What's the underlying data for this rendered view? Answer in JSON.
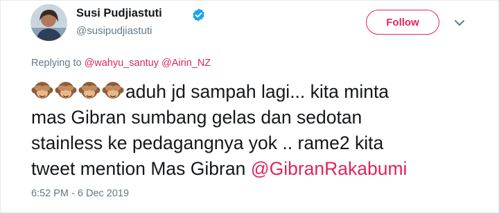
{
  "user": {
    "display_name": "Susi Pudjiastuti",
    "handle": "@susipudjiastuti",
    "verified": true
  },
  "follow_button": {
    "label": "Follow",
    "color": "#e0245e"
  },
  "more_menu": {
    "icon": "chevron-down-icon"
  },
  "reply": {
    "prefix": "Replying to",
    "mentions": [
      "@wahyu_santuy",
      "@Airin_NZ"
    ]
  },
  "tweet": {
    "emoji": [
      "see-no-evil-monkey",
      "see-no-evil-monkey",
      "see-no-evil-monkey",
      "see-no-evil-monkey"
    ],
    "line1": "aduh jd sampah lagi... kita minta",
    "line2": "mas Gibran sumbang gelas dan sedotan",
    "line3": "stainless ke pedagangnya yok .. rame2 kita",
    "line4": "tweet mention Mas Gibran",
    "mention": "@GibranRakabumi"
  },
  "timestamp": "6:52 PM - 6 Dec 2019",
  "colors": {
    "accent": "#e0245e",
    "muted": "#657786",
    "verified": "#1da1f2"
  }
}
